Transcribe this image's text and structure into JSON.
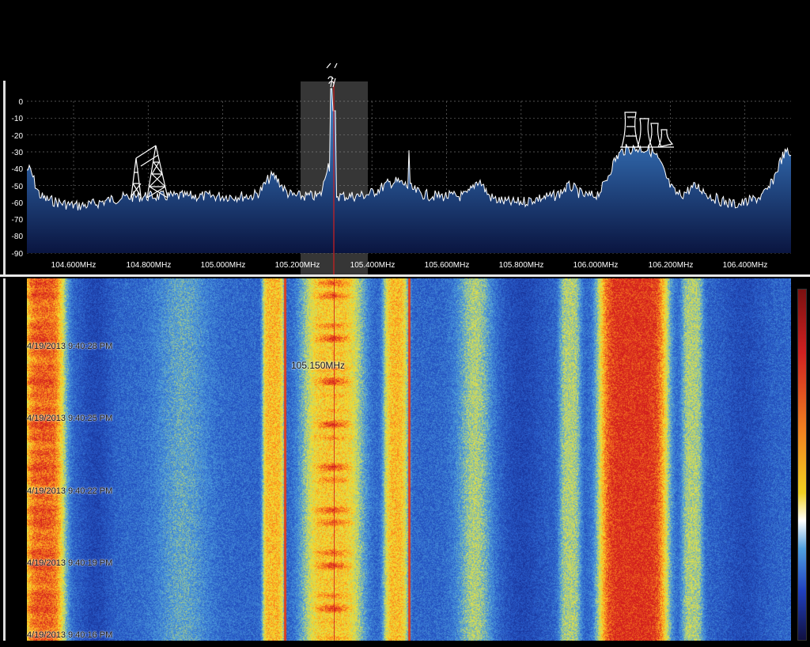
{
  "spectrum": {
    "y_ticks": [
      "0",
      "-10",
      "-20",
      "-30",
      "-40",
      "-50",
      "-60",
      "-70",
      "-80",
      "-90"
    ],
    "x_ticks": [
      "104.600MHz",
      "104.800MHz",
      "105.000MHz",
      "105.200MHz",
      "105.400MHz",
      "105.600MHz",
      "105.800MHz",
      "106.000MHz",
      "106.200MHz",
      "106.400MHz"
    ],
    "selected_frequency": "105.150MHz"
  },
  "waterfall": {
    "timestamps": [
      "4/19/2013 9:40:28 PM",
      "4/19/2013 9:40:25 PM",
      "4/19/2013 9:40:22 PM",
      "4/19/2013 9:40:19 PM",
      "4/19/2013 9:40:16 PM"
    ]
  },
  "colors": {
    "background": "#000000",
    "grid": "#6a6a6a",
    "trace": "#ffffff",
    "fill_top": "#3f7fc0",
    "fill_bottom": "#0a1540",
    "cursor": "#d02020",
    "selection": "#9a9a9a"
  }
}
